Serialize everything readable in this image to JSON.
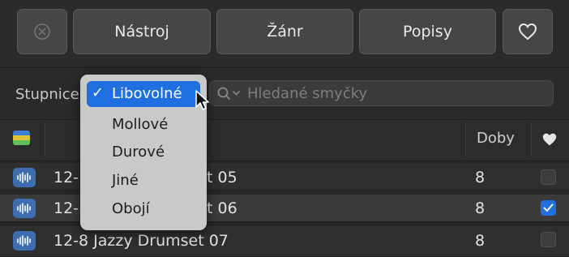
{
  "toolbar": {
    "clear_icon": "x-circle-icon",
    "buttons": [
      {
        "label": "Nástroj"
      },
      {
        "label": "Žánr"
      },
      {
        "label": "Popisy"
      }
    ],
    "favorite_icon": "heart-icon"
  },
  "filter": {
    "scale_label": "Stupnice",
    "search_placeholder": "Hledané smyčky",
    "search_icon": "magnifier-icon"
  },
  "scale_dropdown": {
    "selected": "Libovolné",
    "options": [
      "Libovolné",
      "Mollové",
      "Durové",
      "Jiné",
      "Obojí"
    ]
  },
  "table": {
    "columns": {
      "beats": "Doby",
      "favorite_icon": "heart-icon",
      "type_icon": "color-swatch-icon"
    },
    "rows": [
      {
        "name_prefix": "12-",
        "name_suffix": "t 05",
        "beats": "8",
        "favorite": false
      },
      {
        "name_prefix": "12-",
        "name_suffix": "t 06",
        "beats": "8",
        "favorite": true
      },
      {
        "name": "12-8 Jazzy Drumset 07",
        "beats": "8",
        "favorite": false
      }
    ]
  },
  "colors": {
    "accent": "#1f6fe0",
    "waveform_icon_bg": "#3e6db0"
  }
}
